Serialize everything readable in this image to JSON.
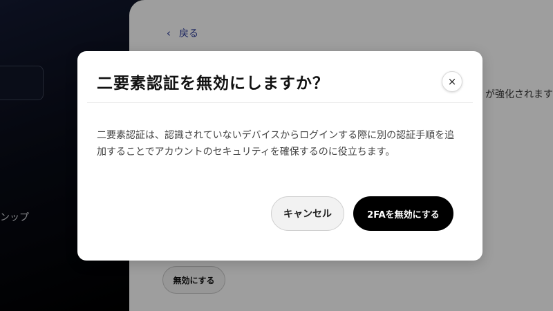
{
  "background": {
    "sidebar": {
      "partial_text": "ンップ"
    },
    "main": {
      "back_label": "戻る",
      "description_fragment": "が強化されます",
      "disable_button_label": "無効にする"
    }
  },
  "modal": {
    "title": "二要素認証を無効にしますか？",
    "close_icon": "×",
    "body": "二要素認証は、認識されていないデバイスからログインする際に別の認証手順を追加することでアカウントのセキュリティを確保するのに役立ちます。",
    "cancel_label": "キャンセル",
    "confirm_label": "2FAを無効にする"
  },
  "colors": {
    "link": "#2b3a9a",
    "confirm_bg": "#000000",
    "overlay": "rgba(0,0,0,0.38)"
  }
}
